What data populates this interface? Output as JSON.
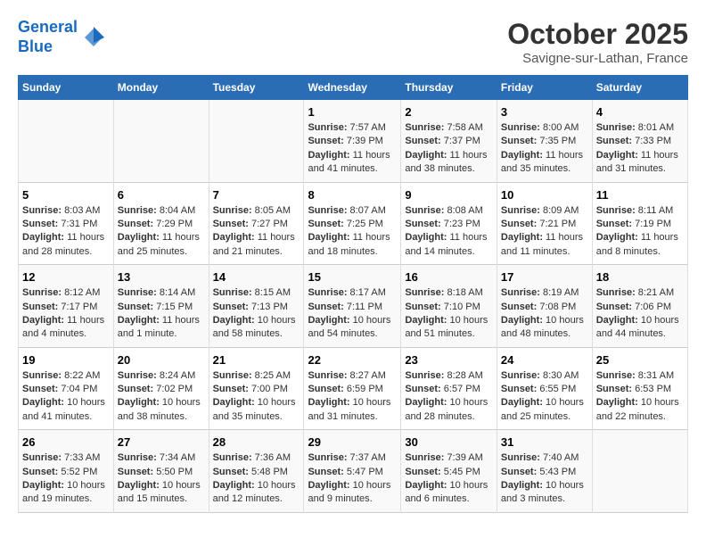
{
  "logo": {
    "line1": "General",
    "line2": "Blue"
  },
  "title": "October 2025",
  "subtitle": "Savigne-sur-Lathan, France",
  "days_header": [
    "Sunday",
    "Monday",
    "Tuesday",
    "Wednesday",
    "Thursday",
    "Friday",
    "Saturday"
  ],
  "weeks": [
    [
      {
        "num": "",
        "info": ""
      },
      {
        "num": "",
        "info": ""
      },
      {
        "num": "",
        "info": ""
      },
      {
        "num": "1",
        "info": "Sunrise: 7:57 AM\nSunset: 7:39 PM\nDaylight: 11 hours and 41 minutes."
      },
      {
        "num": "2",
        "info": "Sunrise: 7:58 AM\nSunset: 7:37 PM\nDaylight: 11 hours and 38 minutes."
      },
      {
        "num": "3",
        "info": "Sunrise: 8:00 AM\nSunset: 7:35 PM\nDaylight: 11 hours and 35 minutes."
      },
      {
        "num": "4",
        "info": "Sunrise: 8:01 AM\nSunset: 7:33 PM\nDaylight: 11 hours and 31 minutes."
      }
    ],
    [
      {
        "num": "5",
        "info": "Sunrise: 8:03 AM\nSunset: 7:31 PM\nDaylight: 11 hours and 28 minutes."
      },
      {
        "num": "6",
        "info": "Sunrise: 8:04 AM\nSunset: 7:29 PM\nDaylight: 11 hours and 25 minutes."
      },
      {
        "num": "7",
        "info": "Sunrise: 8:05 AM\nSunset: 7:27 PM\nDaylight: 11 hours and 21 minutes."
      },
      {
        "num": "8",
        "info": "Sunrise: 8:07 AM\nSunset: 7:25 PM\nDaylight: 11 hours and 18 minutes."
      },
      {
        "num": "9",
        "info": "Sunrise: 8:08 AM\nSunset: 7:23 PM\nDaylight: 11 hours and 14 minutes."
      },
      {
        "num": "10",
        "info": "Sunrise: 8:09 AM\nSunset: 7:21 PM\nDaylight: 11 hours and 11 minutes."
      },
      {
        "num": "11",
        "info": "Sunrise: 8:11 AM\nSunset: 7:19 PM\nDaylight: 11 hours and 8 minutes."
      }
    ],
    [
      {
        "num": "12",
        "info": "Sunrise: 8:12 AM\nSunset: 7:17 PM\nDaylight: 11 hours and 4 minutes."
      },
      {
        "num": "13",
        "info": "Sunrise: 8:14 AM\nSunset: 7:15 PM\nDaylight: 11 hours and 1 minute."
      },
      {
        "num": "14",
        "info": "Sunrise: 8:15 AM\nSunset: 7:13 PM\nDaylight: 10 hours and 58 minutes."
      },
      {
        "num": "15",
        "info": "Sunrise: 8:17 AM\nSunset: 7:11 PM\nDaylight: 10 hours and 54 minutes."
      },
      {
        "num": "16",
        "info": "Sunrise: 8:18 AM\nSunset: 7:10 PM\nDaylight: 10 hours and 51 minutes."
      },
      {
        "num": "17",
        "info": "Sunrise: 8:19 AM\nSunset: 7:08 PM\nDaylight: 10 hours and 48 minutes."
      },
      {
        "num": "18",
        "info": "Sunrise: 8:21 AM\nSunset: 7:06 PM\nDaylight: 10 hours and 44 minutes."
      }
    ],
    [
      {
        "num": "19",
        "info": "Sunrise: 8:22 AM\nSunset: 7:04 PM\nDaylight: 10 hours and 41 minutes."
      },
      {
        "num": "20",
        "info": "Sunrise: 8:24 AM\nSunset: 7:02 PM\nDaylight: 10 hours and 38 minutes."
      },
      {
        "num": "21",
        "info": "Sunrise: 8:25 AM\nSunset: 7:00 PM\nDaylight: 10 hours and 35 minutes."
      },
      {
        "num": "22",
        "info": "Sunrise: 8:27 AM\nSunset: 6:59 PM\nDaylight: 10 hours and 31 minutes."
      },
      {
        "num": "23",
        "info": "Sunrise: 8:28 AM\nSunset: 6:57 PM\nDaylight: 10 hours and 28 minutes."
      },
      {
        "num": "24",
        "info": "Sunrise: 8:30 AM\nSunset: 6:55 PM\nDaylight: 10 hours and 25 minutes."
      },
      {
        "num": "25",
        "info": "Sunrise: 8:31 AM\nSunset: 6:53 PM\nDaylight: 10 hours and 22 minutes."
      }
    ],
    [
      {
        "num": "26",
        "info": "Sunrise: 7:33 AM\nSunset: 5:52 PM\nDaylight: 10 hours and 19 minutes."
      },
      {
        "num": "27",
        "info": "Sunrise: 7:34 AM\nSunset: 5:50 PM\nDaylight: 10 hours and 15 minutes."
      },
      {
        "num": "28",
        "info": "Sunrise: 7:36 AM\nSunset: 5:48 PM\nDaylight: 10 hours and 12 minutes."
      },
      {
        "num": "29",
        "info": "Sunrise: 7:37 AM\nSunset: 5:47 PM\nDaylight: 10 hours and 9 minutes."
      },
      {
        "num": "30",
        "info": "Sunrise: 7:39 AM\nSunset: 5:45 PM\nDaylight: 10 hours and 6 minutes."
      },
      {
        "num": "31",
        "info": "Sunrise: 7:40 AM\nSunset: 5:43 PM\nDaylight: 10 hours and 3 minutes."
      },
      {
        "num": "",
        "info": ""
      }
    ]
  ]
}
